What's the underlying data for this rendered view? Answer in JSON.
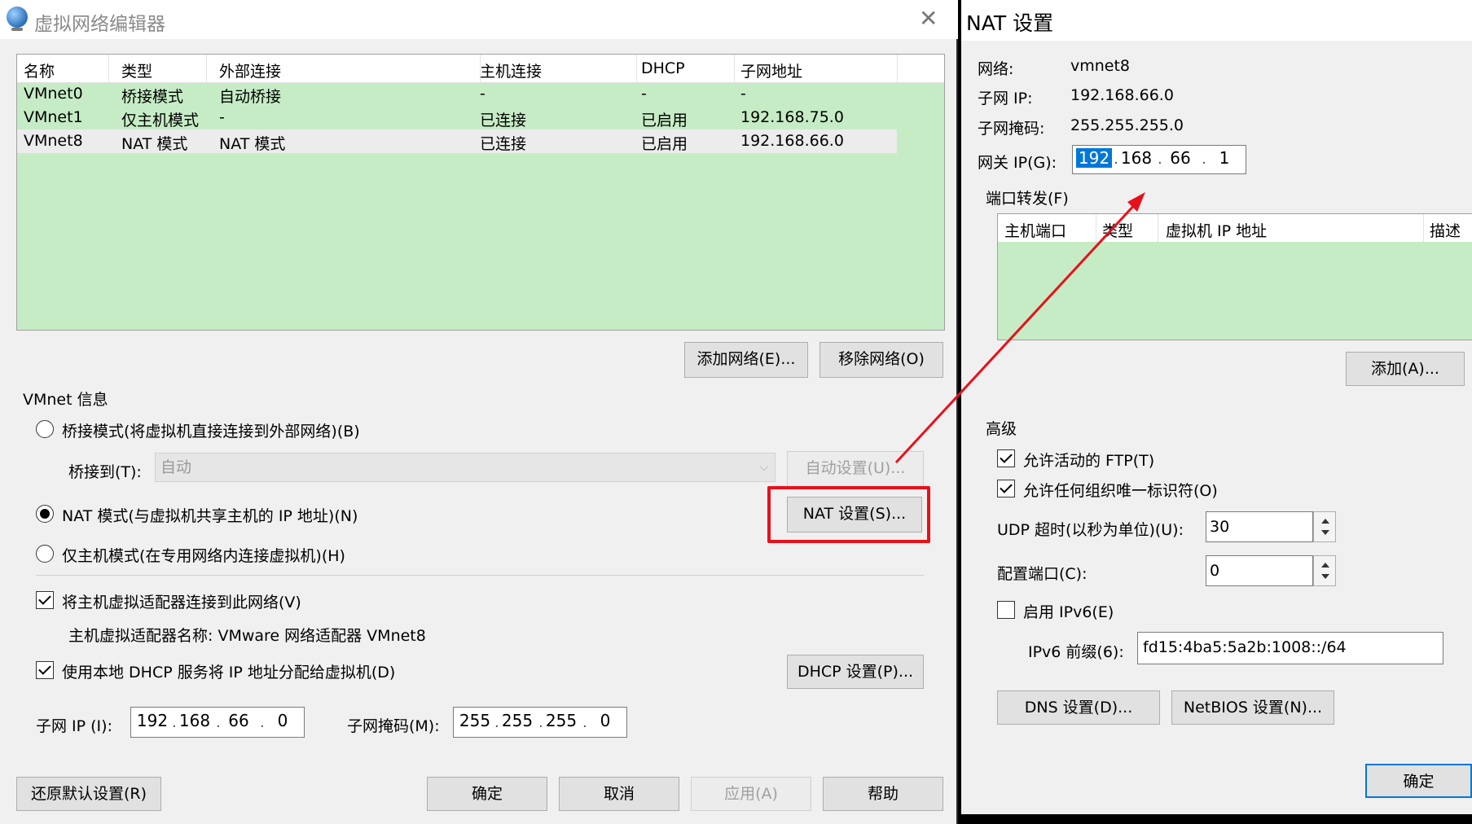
{
  "left_window": {
    "title": "虚拟网络编辑器",
    "close_glyph": "✕",
    "table": {
      "headers": [
        "名称",
        "类型",
        "外部连接",
        "主机连接",
        "DHCP",
        "子网地址"
      ],
      "rows": [
        [
          "VMnet0",
          "桥接模式",
          "自动桥接",
          "-",
          "-",
          "-"
        ],
        [
          "VMnet1",
          "仅主机模式",
          "-",
          "已连接",
          "已启用",
          "192.168.75.0"
        ],
        [
          "VMnet8",
          "NAT 模式",
          "NAT 模式",
          "已连接",
          "已启用",
          "192.168.66.0"
        ]
      ],
      "selected_row": 2
    },
    "buttons": {
      "add_network": "添加网络(E)...",
      "remove_network": "移除网络(O)",
      "auto_settings": "自动设置(U)...",
      "nat_settings": "NAT 设置(S)...",
      "dhcp_settings": "DHCP 设置(P)...",
      "restore_defaults": "还原默认设置(R)",
      "ok": "确定",
      "cancel": "取消",
      "apply": "应用(A)",
      "help": "帮助"
    },
    "vmnet_info_label": "VMnet 信息",
    "radio_bridge": "桥接模式(将虚拟机直接连接到外部网络)(B)",
    "bridge_to_label": "桥接到(T):",
    "bridge_to_value": "自动",
    "radio_nat": "NAT 模式(与虚拟机共享主机的 IP 地址)(N)",
    "radio_hostonly": "仅主机模式(在专用网络内连接虚拟机)(H)",
    "selected_mode": "nat",
    "check_connect_adapter": "将主机虚拟适配器连接到此网络(V)",
    "adapter_name_text": "主机虚拟适配器名称: VMware 网络适配器 VMnet8",
    "check_dhcp": "使用本地 DHCP 服务将 IP 地址分配给虚拟机(D)",
    "subnet_ip_label": "子网 IP (I):",
    "subnet_ip": [
      "192",
      "168",
      "66",
      "0"
    ],
    "subnet_mask_label": "子网掩码(M):",
    "subnet_mask": [
      "255",
      "255",
      "255",
      "0"
    ]
  },
  "nat_window": {
    "title": "NAT 设置",
    "network_label": "网络:",
    "network_value": "vmnet8",
    "subnet_ip_label": "子网 IP:",
    "subnet_ip_value": "192.168.66.0",
    "subnet_mask_label": "子网掩码:",
    "subnet_mask_value": "255.255.255.0",
    "gateway_label": "网关 IP(G):",
    "gateway_ip": [
      "192",
      "168",
      "66",
      "1"
    ],
    "port_forward_label": "端口转发(F)",
    "pf_headers": [
      "主机端口",
      "类型",
      "虚拟机 IP 地址",
      "描述"
    ],
    "add_button": "添加(A)...",
    "advanced_label": "高级",
    "check_ftp": "允许活动的 FTP(T)",
    "check_oui": "允许任何组织唯一标识符(O)",
    "udp_timeout_label": "UDP 超时(以秒为单位)(U):",
    "udp_timeout_value": "30",
    "config_port_label": "配置端口(C):",
    "config_port_value": "0",
    "check_ipv6": "启用 IPv6(E)",
    "ipv6_prefix_label": "IPv6 前缀(6):",
    "ipv6_prefix_value": "fd15:4ba5:5a2b:1008::/64",
    "dns_button": "DNS 设置(D)...",
    "netbios_button": "NetBIOS 设置(N)...",
    "ok_button": "确定"
  },
  "colors": {
    "table_bg": "#c6ecc6",
    "annotation_red": "#e8101a",
    "selection_blue": "#0078d7"
  }
}
